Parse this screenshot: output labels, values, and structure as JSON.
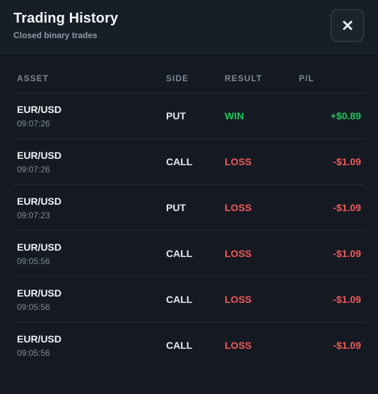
{
  "header": {
    "title": "Trading History",
    "subtitle": "Closed binary trades",
    "close_icon": "close-icon"
  },
  "table": {
    "columns": [
      "ASSET",
      "SIDE",
      "RESULT",
      "P/L"
    ],
    "rows": [
      {
        "asset": "EUR/USD",
        "time": "09:07:26",
        "side": "PUT",
        "result": "WIN",
        "pl": "+$0.89"
      },
      {
        "asset": "EUR/USD",
        "time": "09:07:26",
        "side": "CALL",
        "result": "LOSS",
        "pl": "-$1.09"
      },
      {
        "asset": "EUR/USD",
        "time": "09:07:23",
        "side": "PUT",
        "result": "LOSS",
        "pl": "-$1.09"
      },
      {
        "asset": "EUR/USD",
        "time": "09:05:56",
        "side": "CALL",
        "result": "LOSS",
        "pl": "-$1.09"
      },
      {
        "asset": "EUR/USD",
        "time": "09:05:56",
        "side": "CALL",
        "result": "LOSS",
        "pl": "-$1.09"
      },
      {
        "asset": "EUR/USD",
        "time": "09:05:56",
        "side": "CALL",
        "result": "LOSS",
        "pl": "-$1.09"
      }
    ]
  },
  "colors": {
    "win": "#22c55e",
    "loss": "#f05a5a"
  }
}
